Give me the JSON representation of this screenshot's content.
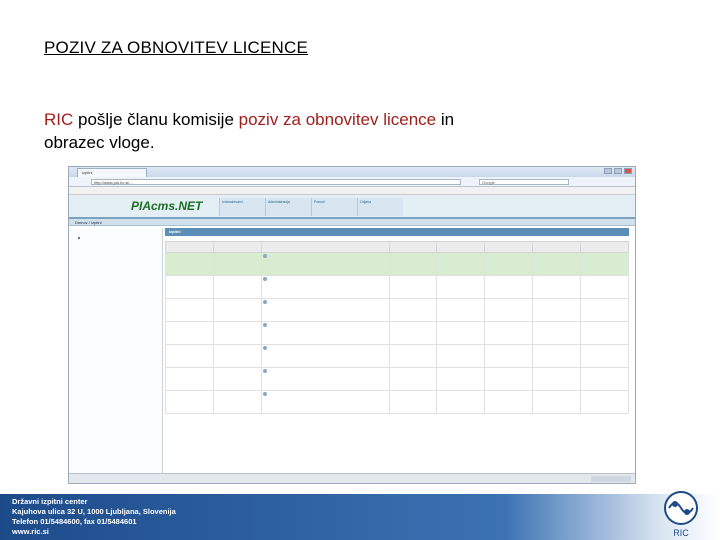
{
  "slide": {
    "title": "POZIV ZA OBNOVITEV LICENCE",
    "body_part1": "RIC ",
    "body_part2": "pošlje članu komisije ",
    "body_part3": "poziv za obnovitev licence ",
    "body_part4": "in obrazec vloge."
  },
  "browser": {
    "tab_title": "Izpitni",
    "url": "http://www.pia.ric.si/...",
    "search_placeholder": "Google",
    "status_text": "",
    "window_buttons": [
      "minimize",
      "maximize",
      "close"
    ]
  },
  "site": {
    "logo": "PIAcms.NET",
    "nav": [
      "Izobraževalni",
      "Administracija",
      "Pomoč",
      "Odjava"
    ],
    "subbar": "Domov / Izpitni",
    "main_header": "Izpitni",
    "crumb": "",
    "crumb2": ""
  },
  "sidebar": {
    "groups": [
      {
        "label": "",
        "items": [
          "",
          "",
          "",
          "",
          "",
          ""
        ]
      },
      {
        "label": "",
        "items": [
          "",
          "",
          "",
          "",
          "",
          "",
          "",
          "",
          "",
          "",
          "",
          "",
          ""
        ]
      },
      {
        "label": "",
        "items": [
          "",
          "",
          "",
          "",
          "",
          "",
          "",
          "",
          "",
          "",
          "",
          "",
          "",
          "",
          "",
          ""
        ]
      },
      {
        "label": "",
        "items": [
          "",
          "",
          "",
          "",
          "",
          ""
        ]
      }
    ]
  },
  "table": {
    "columns": [
      "",
      "",
      "",
      "",
      "",
      "",
      "",
      ""
    ],
    "rows": [
      [
        "",
        "",
        "",
        "",
        "",
        "",
        "",
        ""
      ],
      [
        "",
        "",
        "",
        "",
        "",
        "",
        "",
        ""
      ],
      [
        "",
        "",
        "",
        "",
        "",
        "",
        "",
        ""
      ],
      [
        "",
        "",
        "",
        "",
        "",
        "",
        "",
        ""
      ],
      [
        "",
        "",
        "",
        "",
        "",
        "",
        "",
        ""
      ],
      [
        "",
        "",
        "",
        "",
        "",
        "",
        "",
        ""
      ],
      [
        "",
        "",
        "",
        "",
        "",
        "",
        "",
        ""
      ]
    ],
    "selected_row": 0
  },
  "footer": {
    "line1": "Državni izpitni center",
    "line2": "Kajuhova ulica 32 U, 1000 Ljubljana, Slovenija",
    "line3": "Telefon 01/5484600, fax 01/5484601",
    "line4": "www.ric.si",
    "logo_text": "RIC"
  },
  "colors": {
    "highlight": "#a0201c",
    "footer_blue": "#1d4b8a",
    "selected_row": "#d8ecd0"
  }
}
